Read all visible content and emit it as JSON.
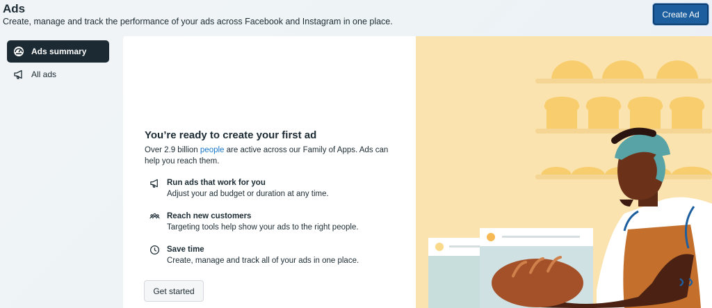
{
  "header": {
    "title": "Ads",
    "subtitle": "Create, manage and track the performance of your ads across Facebook and Instagram in one place.",
    "create_button": "Create Ad"
  },
  "sidebar": {
    "items": [
      {
        "label": "Ads summary",
        "icon": "dashboard-gauge-icon",
        "active": true
      },
      {
        "label": "All ads",
        "icon": "megaphone-icon",
        "active": false
      }
    ]
  },
  "main": {
    "heading": "You’re ready to create your first ad",
    "intro_before": "Over 2.9 billion ",
    "intro_link": "people",
    "intro_after": " are active across our Family of Apps. Ads can help you reach them.",
    "features": [
      {
        "title": "Run ads that work for you",
        "description": "Adjust your ad budget or duration at any time.",
        "icon": "megaphone-icon"
      },
      {
        "title": "Reach new customers",
        "description": "Targeting tools help show your ads to the right people.",
        "icon": "people-group-icon"
      },
      {
        "title": "Save time",
        "description": "Create, manage and track all of your ads in one place.",
        "icon": "clock-icon"
      }
    ],
    "cta": "Get started"
  },
  "colors": {
    "primary_button": "#1d5f9e",
    "sidebar_active": "#1c2b33",
    "link": "#1877c9",
    "illustration_bg": "#fbe3b0"
  }
}
